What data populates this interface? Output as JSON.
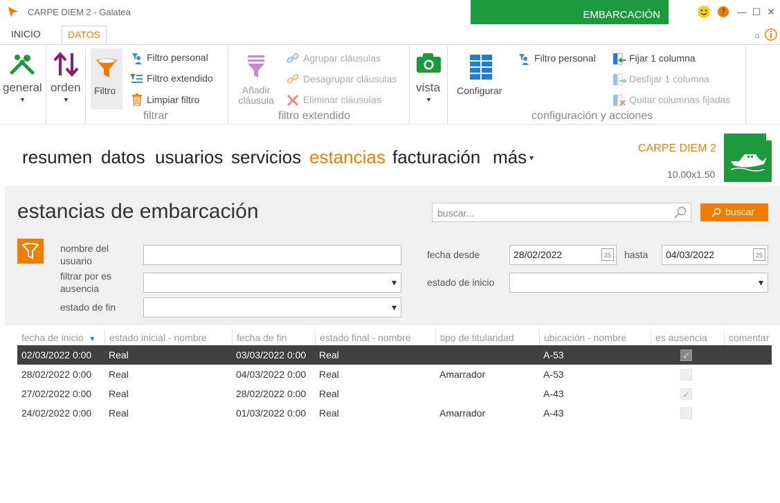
{
  "window": {
    "title": "CARPE DIEM 2 - Galatea",
    "context_tab": "EMBARCACIÓN"
  },
  "ribbon_tabs": [
    {
      "label": "INICIO",
      "active": false
    },
    {
      "label": "DATOS",
      "active": true
    }
  ],
  "ribbon": {
    "general": {
      "label": "general",
      "icon": "tools-icon"
    },
    "orden": {
      "label": "orden",
      "icon": "sort-arrows-icon"
    },
    "filtro": {
      "label": "Filtro",
      "icon": "funnel-icon"
    },
    "filtrar_items": [
      "Filtro personal",
      "Filtro extendido",
      "Limpiar filtro"
    ],
    "filtrar_group": "filtrar",
    "anadir_clausula": "Añadir\ncláusula",
    "clausula_items": [
      "Agrupar cláusulas",
      "Desagrupar cláusulas",
      "Eliminar cláusulas"
    ],
    "filtro_extendido_group": "filtro extendido",
    "vista": "vista",
    "configurar": "Configurar",
    "config_items_left": [
      "Filtro personal"
    ],
    "config_items_right": [
      "Fijar 1 columna",
      "Desfijar 1 columna",
      "Quitar columnas fijadas"
    ],
    "config_group": "configuración y acciones"
  },
  "nav": {
    "links": [
      "resumen",
      "datos",
      "usuarios",
      "servicios",
      "estancias",
      "facturación",
      "más"
    ],
    "active": "estancias"
  },
  "vessel": {
    "name": "CARPE DIEM 2",
    "dimensions": "10.00x1.50"
  },
  "page": {
    "title": "estancias de embarcación",
    "search_placeholder": "buscar...",
    "search_button": "buscar"
  },
  "filters": {
    "nombre_usuario_label": "nombre del usuario",
    "nombre_usuario_value": "",
    "ausencia_label": "filtrar por es ausencia",
    "estado_fin_label": "estado de fin",
    "fecha_desde_label": "fecha desde",
    "fecha_desde_value": "28/02/2022",
    "hasta_label": "hasta",
    "hasta_value": "04/03/2022",
    "estado_inicio_label": "estado de inicio",
    "calendar_day": "25"
  },
  "table": {
    "columns": [
      "fecha de inicio",
      "estado inicial - nombre",
      "fecha de fin",
      "estado final - nombre",
      "tipo de titularidad",
      "ubicación - nombre",
      "es ausencia",
      "comentar"
    ],
    "rows": [
      {
        "inicio": "02/03/2022 0:00",
        "estado_ini": "Real",
        "fin": "03/03/2022 0:00",
        "estado_fin": "Real",
        "titularidad": "",
        "ubicacion": "A-53",
        "ausencia": true,
        "selected": true
      },
      {
        "inicio": "28/02/2022 0:00",
        "estado_ini": "Real",
        "fin": "04/03/2022 0:00",
        "estado_fin": "Real",
        "titularidad": "Amarrador",
        "ubicacion": "A-53",
        "ausencia": false,
        "selected": false
      },
      {
        "inicio": "27/02/2022 0:00",
        "estado_ini": "Real",
        "fin": "28/02/2022 0:00",
        "estado_fin": "Real",
        "titularidad": "",
        "ubicacion": "A-43",
        "ausencia": true,
        "selected": false
      },
      {
        "inicio": "24/02/2022 0:00",
        "estado_ini": "Real",
        "fin": "01/03/2022 0:00",
        "estado_fin": "Real",
        "titularidad": "Amarrador",
        "ubicacion": "A-43",
        "ausencia": false,
        "selected": false
      }
    ]
  },
  "colors": {
    "accent": "#f07d00",
    "brand_green": "#1e9a3e",
    "selected_row": "#404040"
  }
}
